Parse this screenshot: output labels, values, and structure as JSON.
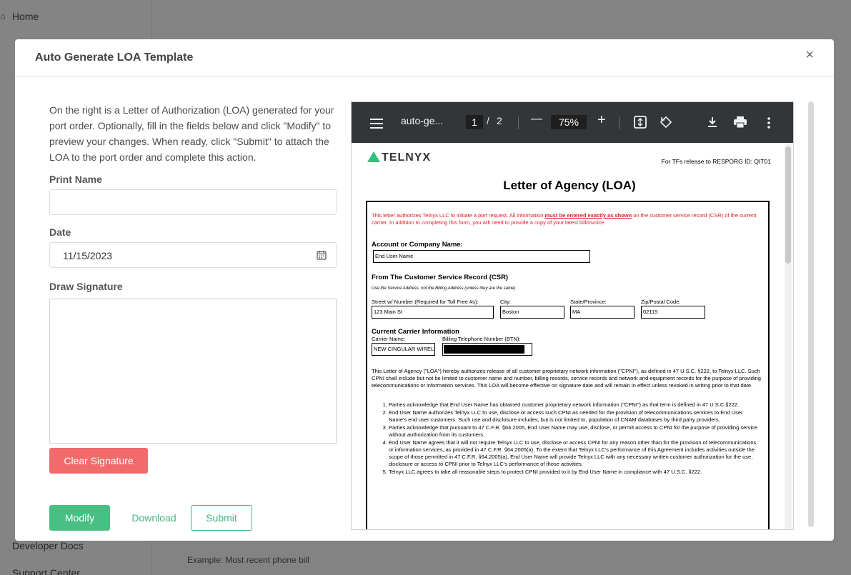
{
  "background": {
    "sidebar_items": [
      "Home",
      "Developer Docs",
      "Support Center"
    ],
    "hint_text": "Example: Most recent phone bill"
  },
  "modal": {
    "title": "Auto Generate LOA Template",
    "close_label": "×",
    "intro": "On the right is a Letter of Authorization (LOA) generated for your port order. Optionally, fill in the fields below and click \"Modify\" to preview your changes. When ready, click \"Submit\" to attach the LOA to the port order and complete this action.",
    "print_name_label": "Print Name",
    "print_name_value": "",
    "date_label": "Date",
    "date_value": "11/15/2023",
    "signature_label": "Draw Signature",
    "clear_signature": "Clear Signature",
    "modify": "Modify",
    "download": "Download",
    "submit": "Submit"
  },
  "pdf": {
    "filename": "auto-ge...",
    "page_current": "1",
    "page_sep": "/",
    "page_total": "2",
    "zoom": "75%",
    "zoom_out": "—",
    "zoom_in": "+"
  },
  "loa": {
    "logo_text": "TELNYX",
    "resporg": "For TFs release to RESPORG ID: QIT01",
    "title": "Letter of Agency (LOA)",
    "red_intro_a": "This letter authorizes Telnyx LLC to initiate a port request. All information ",
    "red_intro_b": "must be entered exactly as shown",
    "red_intro_c": " on the customer service record (CSR) of the current carrier. In addition to completing this form, you will need to provide a copy of your latest bill/invoice.",
    "account_label": "Account or Company Name:",
    "account_value": "End User Name",
    "csr_label": "From The Customer Service Record (CSR)",
    "csr_note": "Use the Service Address, not the Billing Address (unless they are the same)",
    "street_label": "Street w/ Number (Required for Toll Free #s):",
    "street_value": "123 Main St",
    "city_label": "City:",
    "city_value": "Boston",
    "state_label": "State/Province:",
    "state_value": "MA",
    "zip_label": "Zip/Postal Code:",
    "zip_value": "02115",
    "carrier_section": "Current Carrier Information",
    "carrier_label": "Carrier Name:",
    "carrier_value": "NEW CINGULAR WIRELESS",
    "btn_label": "Billing Telephone Number (BTN):",
    "cpni_para": "This Letter of Agency (\"LOA\") hereby authorizes release of all customer proprietary network information (\"CPNI\"), as defined in 47 U.S.C. §222, to Telnyx LLC. Such CPNI shall include but not be limited to customer name and number, billing records, service records and network and equipment records for the purpose of providing telecommunications or information services. This LOA will become effective on signature date and will remain in effect unless revoked in writing prior to that date.",
    "items": [
      "Parties acknowledge that End User Name has obtained customer proprietary network information (\"CPNI\") as that term is defined in 47 U.S.C.§222.",
      "End User Name authorizes Telnyx LLC to use, disclose or access such CPNI as needed for the provision of telecommunications services to End User Name's end user customers. Such use and disclosure includes, but is not limited to, population of CNAM databases by third party providers.",
      "Parties acknowledge that pursuant to 47 C.F.R. §64.2005, End User Name may use, disclose, or permit access to CPNI for the purpose of providing service without authorization from its customers.",
      "End User Name agrees that it will not require Telnyx LLC to use, disclose or access CPNI for any reason other than for the provision of telecommunications or information services, as provided in 47 C.F.R. §64.2005(a). To the extent that Telnyx LLC's performance of this Agreement includes activities outside the scope of those permitted in 47 C.F.R. §64.2005(a), End User Name will provide Telnyx LLC with any necessary written customer authorization for the use, disclosure or access to CPNI prior to Telnyx LLC's performance of those activities.",
      "Telnyx LLC agrees to take all reasonable steps to protect CPNI provided to it by End User Name in compliance with 47 U.S.C. §222."
    ]
  }
}
